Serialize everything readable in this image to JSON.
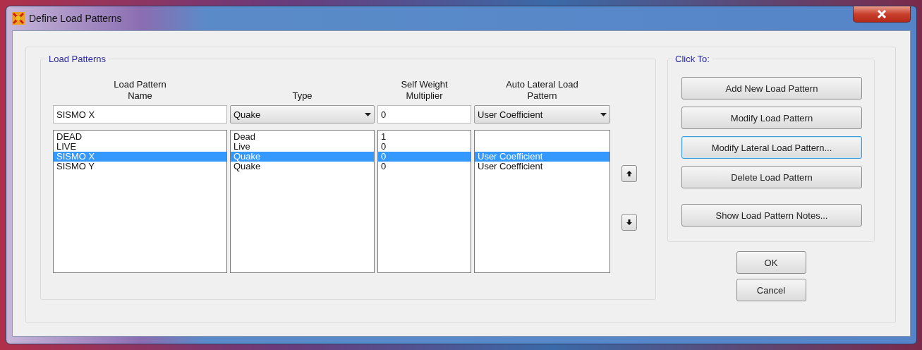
{
  "window": {
    "title": "Define Load Patterns"
  },
  "load_patterns": {
    "title": "Load Patterns",
    "columns": [
      "Load Pattern Name",
      "Type",
      "Self Weight Multiplier",
      "Auto Lateral Load Pattern"
    ],
    "edit_row": {
      "name": "SISMO X",
      "type": "Quake",
      "multiplier": "0",
      "auto_lateral": "User Coefficient"
    },
    "rows": [
      {
        "name": "DEAD",
        "type": "Dead",
        "multiplier": "1",
        "selected": false
      },
      {
        "name": "LIVE",
        "type": "Live",
        "multiplier": "0",
        "selected": false
      },
      {
        "name": "SISMO X",
        "type": "Quake",
        "multiplier": "0",
        "auto_lateral": "User Coefficient",
        "selected": true
      },
      {
        "name": "SISMO Y",
        "type": "Quake",
        "multiplier": "0",
        "auto_lateral": "User Coefficient",
        "selected": false
      }
    ]
  },
  "click_to": {
    "title": "Click To:",
    "buttons": [
      {
        "label": "Add New Load Pattern",
        "focused": false
      },
      {
        "label": "Modify Load Pattern",
        "focused": false
      },
      {
        "label": "Modify Lateral Load Pattern...",
        "focused": true
      },
      {
        "label": "Delete Load Pattern",
        "focused": false
      },
      {
        "label": "Show Load Pattern Notes...",
        "focused": false
      }
    ]
  },
  "dialog_buttons": [
    "OK",
    "Cancel"
  ]
}
